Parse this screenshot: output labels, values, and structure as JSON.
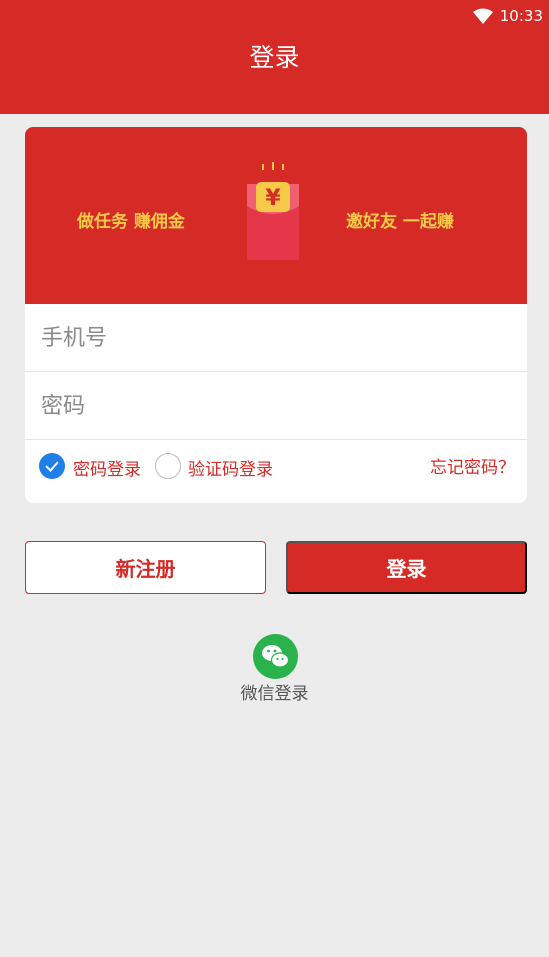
{
  "status_bar": {
    "time": "10:33",
    "wifi_icon": "wifi-icon"
  },
  "header": {
    "title": "登录"
  },
  "banner": {
    "left_slogan": "做任务 赚佣金",
    "right_slogan": "邀好友 一起赚",
    "envelope_icon": "red-envelope-icon",
    "envelope_symbol": "¥"
  },
  "form": {
    "phone_placeholder": "手机号",
    "password_placeholder": "密码",
    "login_mode_password": {
      "label": "密码登录",
      "selected": true
    },
    "login_mode_sms": {
      "label": "验证码登录",
      "selected": false
    },
    "forgot_password": "忘记密码？"
  },
  "buttons": {
    "register": "新注册",
    "login": "登录"
  },
  "wechat": {
    "icon": "wechat-icon",
    "label": "微信登录"
  },
  "colors": {
    "primary": "#d52a26",
    "accent_yellow": "#f7c948",
    "radio_selected": "#1f7fe6",
    "wechat_green": "#2ab24d",
    "background": "#ececec"
  }
}
